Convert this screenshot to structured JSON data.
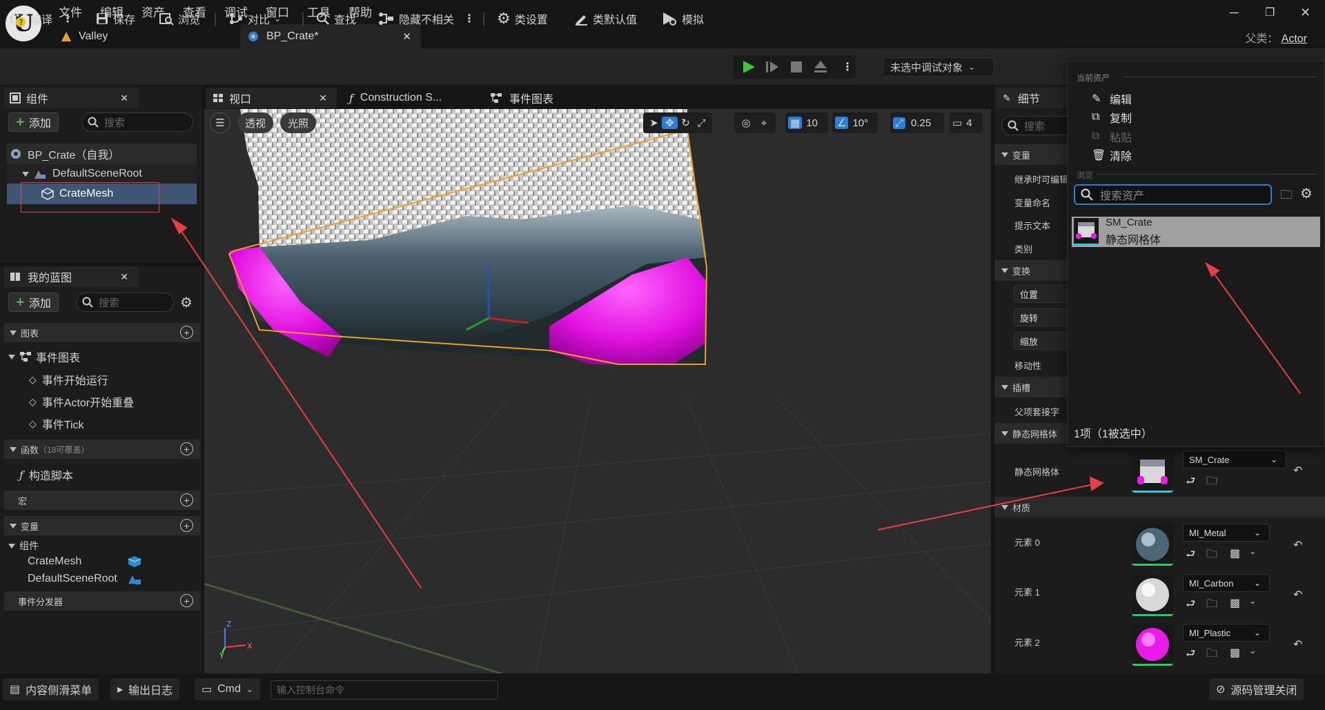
{
  "menu": [
    "文件",
    "编辑",
    "资产",
    "查看",
    "调试",
    "窗口",
    "工具",
    "帮助"
  ],
  "tabs": [
    {
      "label": "Valley"
    },
    {
      "label": "BP_Crate*"
    }
  ],
  "parent_class": {
    "label": "父类：",
    "value": "Actor"
  },
  "toolbar": {
    "compile": "编译",
    "save": "保存",
    "browse": "浏览",
    "diff": "对比",
    "find": "查找",
    "hide_unrelated": "隐藏不相关",
    "class_settings": "类设置",
    "class_defaults": "类默认值",
    "simulate": "模拟",
    "debug_object": "未选中调试对象"
  },
  "components_panel": {
    "title": "组件",
    "add": "添加",
    "search_placeholder": "搜索",
    "tree": [
      {
        "label": "BP_Crate（自我）"
      },
      {
        "label": "DefaultSceneRoot"
      },
      {
        "label": "CrateMesh"
      }
    ]
  },
  "my_blueprint": {
    "title": "我的蓝图",
    "add": "添加",
    "search_placeholder": "搜索",
    "graphs": "图表",
    "event_graph": "事件图表",
    "events": [
      "事件开始运行",
      "事件Actor开始重叠",
      "事件Tick"
    ],
    "functions": "函数",
    "functions_note": "（18可覆盖）",
    "construction_script": "构造脚本",
    "macros": "宏",
    "variables": "变量",
    "components_group": "组件",
    "component_vars": [
      "CrateMesh",
      "DefaultSceneRoot"
    ],
    "event_dispatchers": "事件分发器"
  },
  "viewport": {
    "tabs": [
      {
        "label": "视口"
      },
      {
        "label": "Construction S..."
      },
      {
        "label": "事件图表"
      }
    ],
    "perspective": "透视",
    "lighting": "光照",
    "grid_snap": "10",
    "rotation_snap": "10°",
    "scale_snap": "0.25",
    "camera_speed": "4"
  },
  "details": {
    "title": "细节",
    "search_placeholder": "搜索",
    "sections": {
      "variable": "变量",
      "transform": "变换",
      "sockets": "插槽",
      "static_mesh": "静态网格体",
      "materials": "材质"
    },
    "variable_rows": [
      "继承时可编辑",
      "变量命名",
      "提示文本",
      "类别"
    ],
    "transform_rows": [
      "位置",
      "旋转",
      "缩放",
      "移动性"
    ],
    "socket_rows": [
      "父项套接字"
    ],
    "static_mesh_label": "静态网格体",
    "static_mesh_value": "SM_Crate",
    "materials": [
      {
        "label": "元素 0",
        "value": "MI_Metal"
      },
      {
        "label": "元素 1",
        "value": "MI_Carbon"
      },
      {
        "label": "元素 2",
        "value": "MI_Plastic"
      }
    ]
  },
  "asset_popup": {
    "current_asset": "当前资产",
    "edit": "编辑",
    "copy": "复制",
    "paste": "粘贴",
    "clear": "清除",
    "browse": "浏览",
    "search_placeholder": "搜索资产",
    "result_name": "SM_Crate",
    "result_type": "静态网格体",
    "count": "1项（1被选中）"
  },
  "statusbar": {
    "content_drawer": "内容侧滑菜单",
    "output_log": "输出日志",
    "cmd": "Cmd",
    "console_placeholder": "输入控制台命令",
    "source_control": "源码管理关闭"
  },
  "colors": {
    "play_green": "#3cc63c",
    "accent_blue": "#2b7fd4",
    "highlight_red": "#e84040",
    "magenta": "#e81ce8"
  }
}
